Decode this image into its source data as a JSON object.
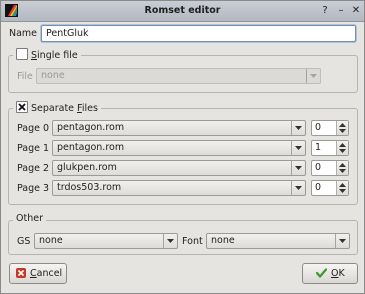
{
  "window": {
    "title": "Romset editor"
  },
  "name": {
    "label": "Name",
    "value": "PentGluk"
  },
  "single_file": {
    "title_first": "S",
    "title_rest": "ingle file",
    "checked": false,
    "file_label": "File",
    "file_value": "none"
  },
  "separate_files": {
    "title_first": "Separate ",
    "title_underline": "F",
    "title_rest": "iles",
    "checked": true,
    "pages": [
      {
        "label": "Page 0",
        "file": "pentagon.rom",
        "number": "0"
      },
      {
        "label": "Page 1",
        "file": "pentagon.rom",
        "number": "1"
      },
      {
        "label": "Page 2",
        "file": "glukpen.rom",
        "number": "0"
      },
      {
        "label": "Page 3",
        "file": "trdos503.rom",
        "number": "0"
      }
    ]
  },
  "other": {
    "title": "Other",
    "gs_label": "GS",
    "gs_value": "none",
    "font_label": "Font",
    "font_value": "none"
  },
  "buttons": {
    "cancel_first": "C",
    "cancel_rest": "ancel",
    "ok_first": "O",
    "ok_rest": "K"
  },
  "colors": {
    "title_bar": "#bfc4cb",
    "accent": "#a8c2e8",
    "cancel_icon": "#c0392b",
    "ok_icon": "#3c9a2c"
  },
  "icons": [
    "app-icon",
    "help-icon",
    "minimize-icon",
    "close-icon",
    "cancel-icon",
    "ok-icon",
    "chevron-down-icon"
  ]
}
